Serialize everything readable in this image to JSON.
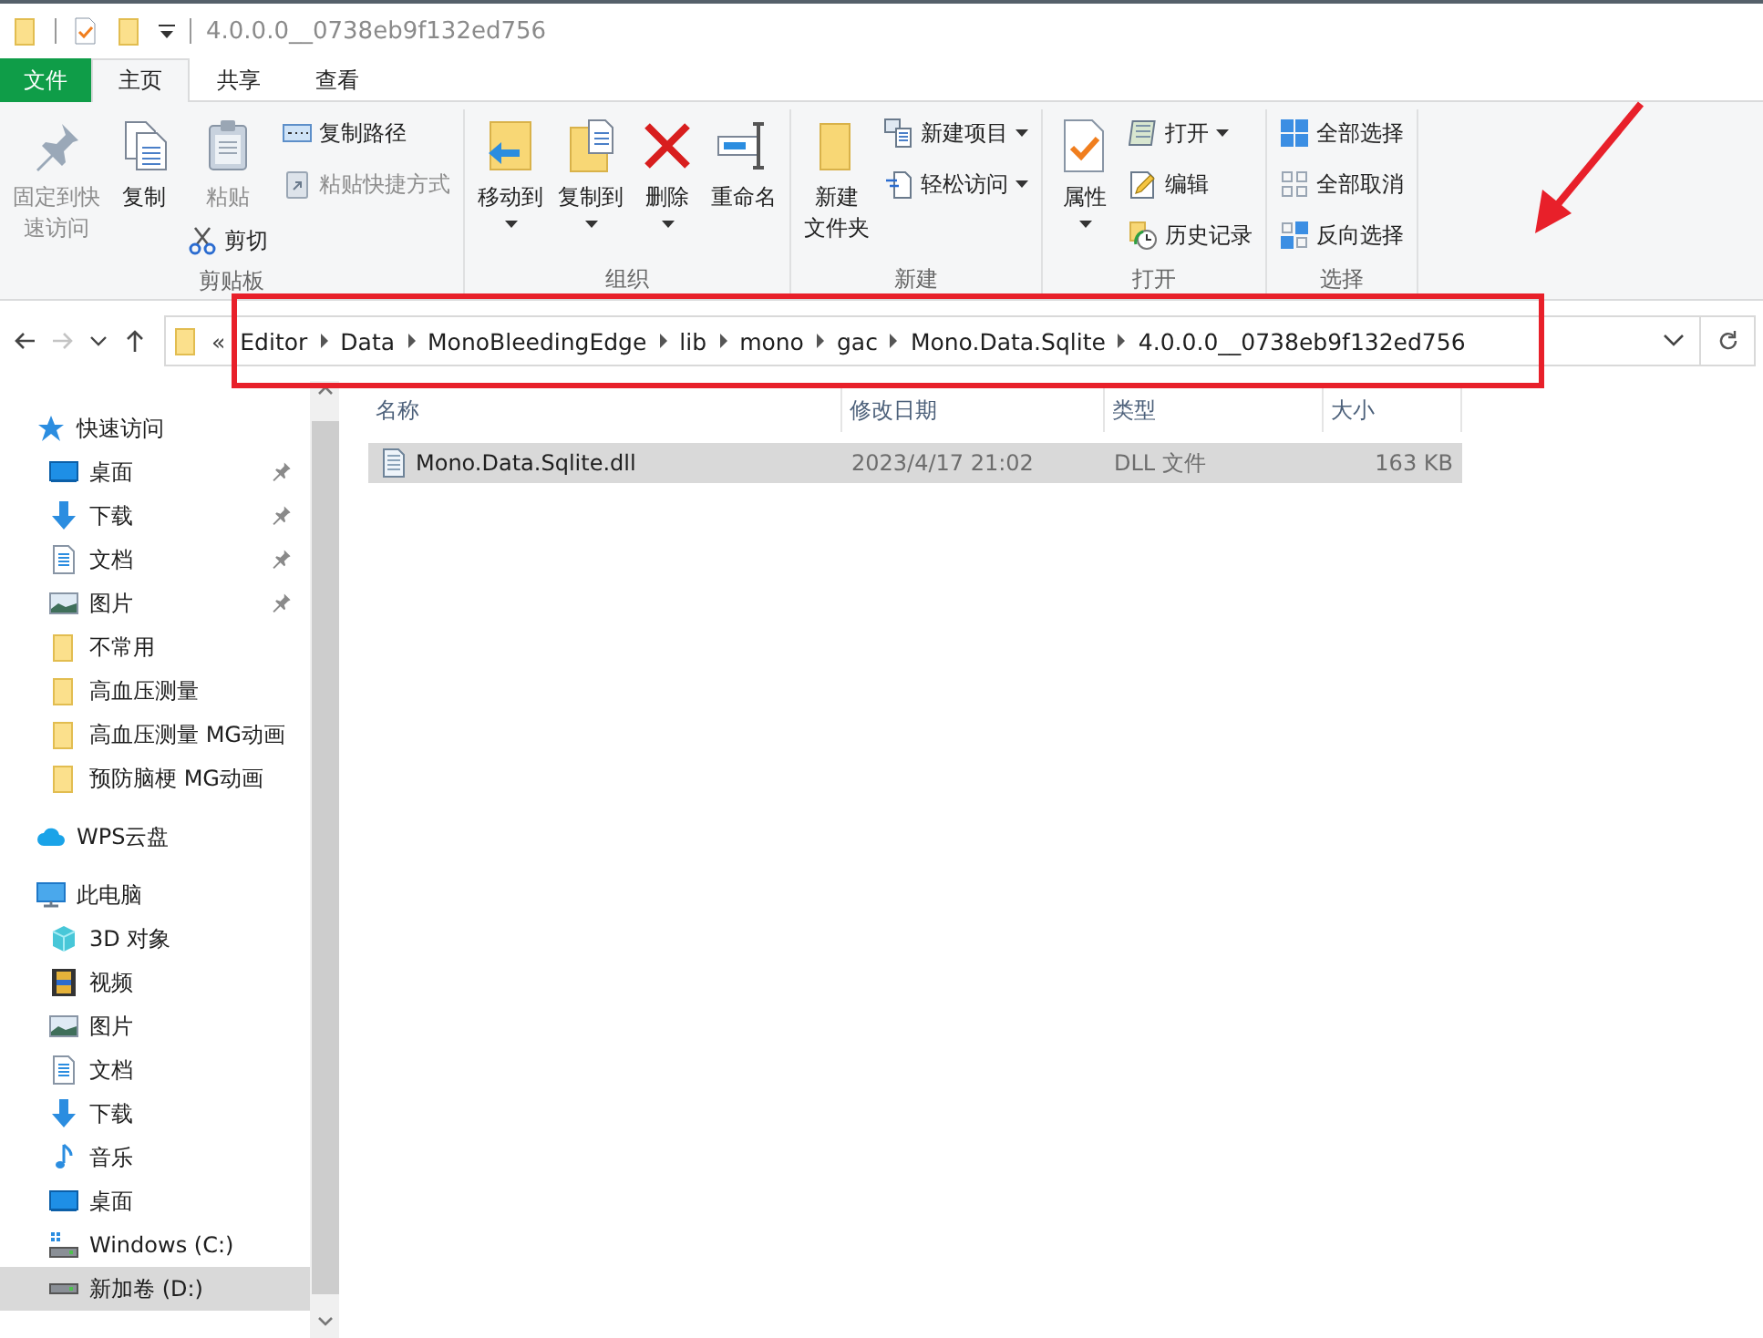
{
  "window": {
    "title": "4.0.0.0__0738eb9f132ed756"
  },
  "ribbon_tabs": [
    {
      "label": "文件",
      "kind": "file",
      "selected": false
    },
    {
      "label": "主页",
      "kind": "tab",
      "selected": true
    },
    {
      "label": "共享",
      "kind": "tab",
      "selected": false
    },
    {
      "label": "查看",
      "kind": "tab",
      "selected": false
    }
  ],
  "ribbon": {
    "groups": [
      {
        "label": "剪贴板",
        "columns": [
          [
            {
              "label_lines": [
                "固定到快",
                "速访问"
              ],
              "kind": "pin",
              "large": true,
              "disabled": true,
              "dropdown": false
            }
          ],
          [
            {
              "label": "复制",
              "kind": "copy",
              "large": true,
              "disabled": false,
              "dropdown": false
            }
          ],
          [
            {
              "label": "粘贴",
              "kind": "paste",
              "large": true,
              "disabled": true,
              "dropdown": false
            },
            {
              "label": "剪切",
              "kind": "cut",
              "large": false,
              "disabled": false,
              "dropdown": false
            }
          ],
          [
            {
              "label": "复制路径",
              "kind": "copypath",
              "large": false,
              "disabled": false,
              "dropdown": false
            },
            {
              "label": "粘贴快捷方式",
              "kind": "pasteshortcut",
              "large": false,
              "disabled": true,
              "dropdown": false
            }
          ]
        ]
      },
      {
        "label": "组织",
        "columns": [
          [
            {
              "label": "移动到",
              "kind": "moveto",
              "large": true,
              "disabled": false,
              "dropdown": true
            }
          ],
          [
            {
              "label": "复制到",
              "kind": "copyto",
              "large": true,
              "disabled": false,
              "dropdown": true
            }
          ],
          [
            {
              "label": "删除",
              "kind": "delete",
              "large": true,
              "disabled": false,
              "dropdown": true
            }
          ],
          [
            {
              "label": "重命名",
              "kind": "rename",
              "large": true,
              "disabled": false,
              "dropdown": false
            }
          ]
        ]
      },
      {
        "label": "新建",
        "columns": [
          [
            {
              "label_lines": [
                "新建",
                "文件夹"
              ],
              "kind": "newfolder",
              "large": true,
              "disabled": false,
              "dropdown": false
            }
          ],
          [
            {
              "label": "新建项目",
              "kind": "newitem",
              "large": false,
              "disabled": false,
              "dropdown": true
            },
            {
              "label": "轻松访问",
              "kind": "easyaccess",
              "large": false,
              "disabled": false,
              "dropdown": true
            }
          ]
        ]
      },
      {
        "label": "打开",
        "columns": [
          [
            {
              "label": "属性",
              "kind": "properties",
              "large": true,
              "disabled": false,
              "dropdown": true
            }
          ],
          [
            {
              "label": "打开",
              "kind": "open",
              "large": false,
              "disabled": false,
              "dropdown": true
            },
            {
              "label": "编辑",
              "kind": "edit",
              "large": false,
              "disabled": false,
              "dropdown": false
            },
            {
              "label": "历史记录",
              "kind": "history",
              "large": false,
              "disabled": false,
              "dropdown": false
            }
          ]
        ]
      },
      {
        "label": "选择",
        "columns": [
          [
            {
              "label": "全部选择",
              "kind": "selectall",
              "large": false,
              "disabled": false,
              "dropdown": false
            },
            {
              "label": "全部取消",
              "kind": "selectnone",
              "large": false,
              "disabled": false,
              "dropdown": false
            },
            {
              "label": "反向选择",
              "kind": "invert",
              "large": false,
              "disabled": false,
              "dropdown": false
            }
          ]
        ]
      }
    ]
  },
  "address": {
    "nav_buttons": [
      {
        "kind": "back",
        "disabled": false
      },
      {
        "kind": "forward",
        "disabled": true
      },
      {
        "kind": "recent",
        "disabled": false
      },
      {
        "kind": "up",
        "disabled": false
      }
    ],
    "overflow": "«",
    "segments": [
      "Editor",
      "Data",
      "MonoBleedingEdge",
      "lib",
      "mono",
      "gac",
      "Mono.Data.Sqlite",
      "4.0.0.0__0738eb9f132ed756"
    ]
  },
  "nav_pane": {
    "sections": [
      {
        "label": "快速访问",
        "kind": "star",
        "selected": false,
        "children": [
          {
            "label": "桌面",
            "kind": "desktop",
            "pinned": true,
            "selected": false
          },
          {
            "label": "下载",
            "kind": "download",
            "pinned": true,
            "selected": false
          },
          {
            "label": "文档",
            "kind": "document",
            "pinned": true,
            "selected": false
          },
          {
            "label": "图片",
            "kind": "pictures",
            "pinned": true,
            "selected": false
          },
          {
            "label": "不常用",
            "kind": "folder",
            "pinned": false,
            "selected": false
          },
          {
            "label": "高血压测量",
            "kind": "folder",
            "pinned": false,
            "selected": false
          },
          {
            "label": "高血压测量 MG动画",
            "kind": "folder",
            "pinned": false,
            "selected": false
          },
          {
            "label": "预防脑梗 MG动画",
            "kind": "folder",
            "pinned": false,
            "selected": false
          }
        ]
      },
      {
        "label": "WPS云盘",
        "kind": "cloud",
        "selected": false
      },
      {
        "label": "此电脑",
        "kind": "pc",
        "selected": false,
        "children": [
          {
            "label": "3D 对象",
            "kind": "cube",
            "pinned": false,
            "selected": false
          },
          {
            "label": "视频",
            "kind": "video",
            "pinned": false,
            "selected": false
          },
          {
            "label": "图片",
            "kind": "pictures",
            "pinned": false,
            "selected": false
          },
          {
            "label": "文档",
            "kind": "document",
            "pinned": false,
            "selected": false
          },
          {
            "label": "下载",
            "kind": "download",
            "pinned": false,
            "selected": false
          },
          {
            "label": "音乐",
            "kind": "music",
            "pinned": false,
            "selected": false
          },
          {
            "label": "桌面",
            "kind": "desktop",
            "pinned": false,
            "selected": false
          },
          {
            "label": "Windows (C:)",
            "kind": "systemdrive",
            "pinned": false,
            "selected": false
          },
          {
            "label": "新加卷 (D:)",
            "kind": "drive",
            "pinned": false,
            "selected": true
          }
        ]
      }
    ]
  },
  "files": {
    "columns": [
      "名称",
      "修改日期",
      "类型",
      "大小"
    ],
    "rows": [
      {
        "cells": [
          "Mono.Data.Sqlite.dll",
          "2023/4/17 21:02",
          "DLL 文件",
          "163 KB"
        ],
        "selected": true
      }
    ]
  },
  "annotations": {
    "highlight_box": true,
    "arrow": true
  }
}
